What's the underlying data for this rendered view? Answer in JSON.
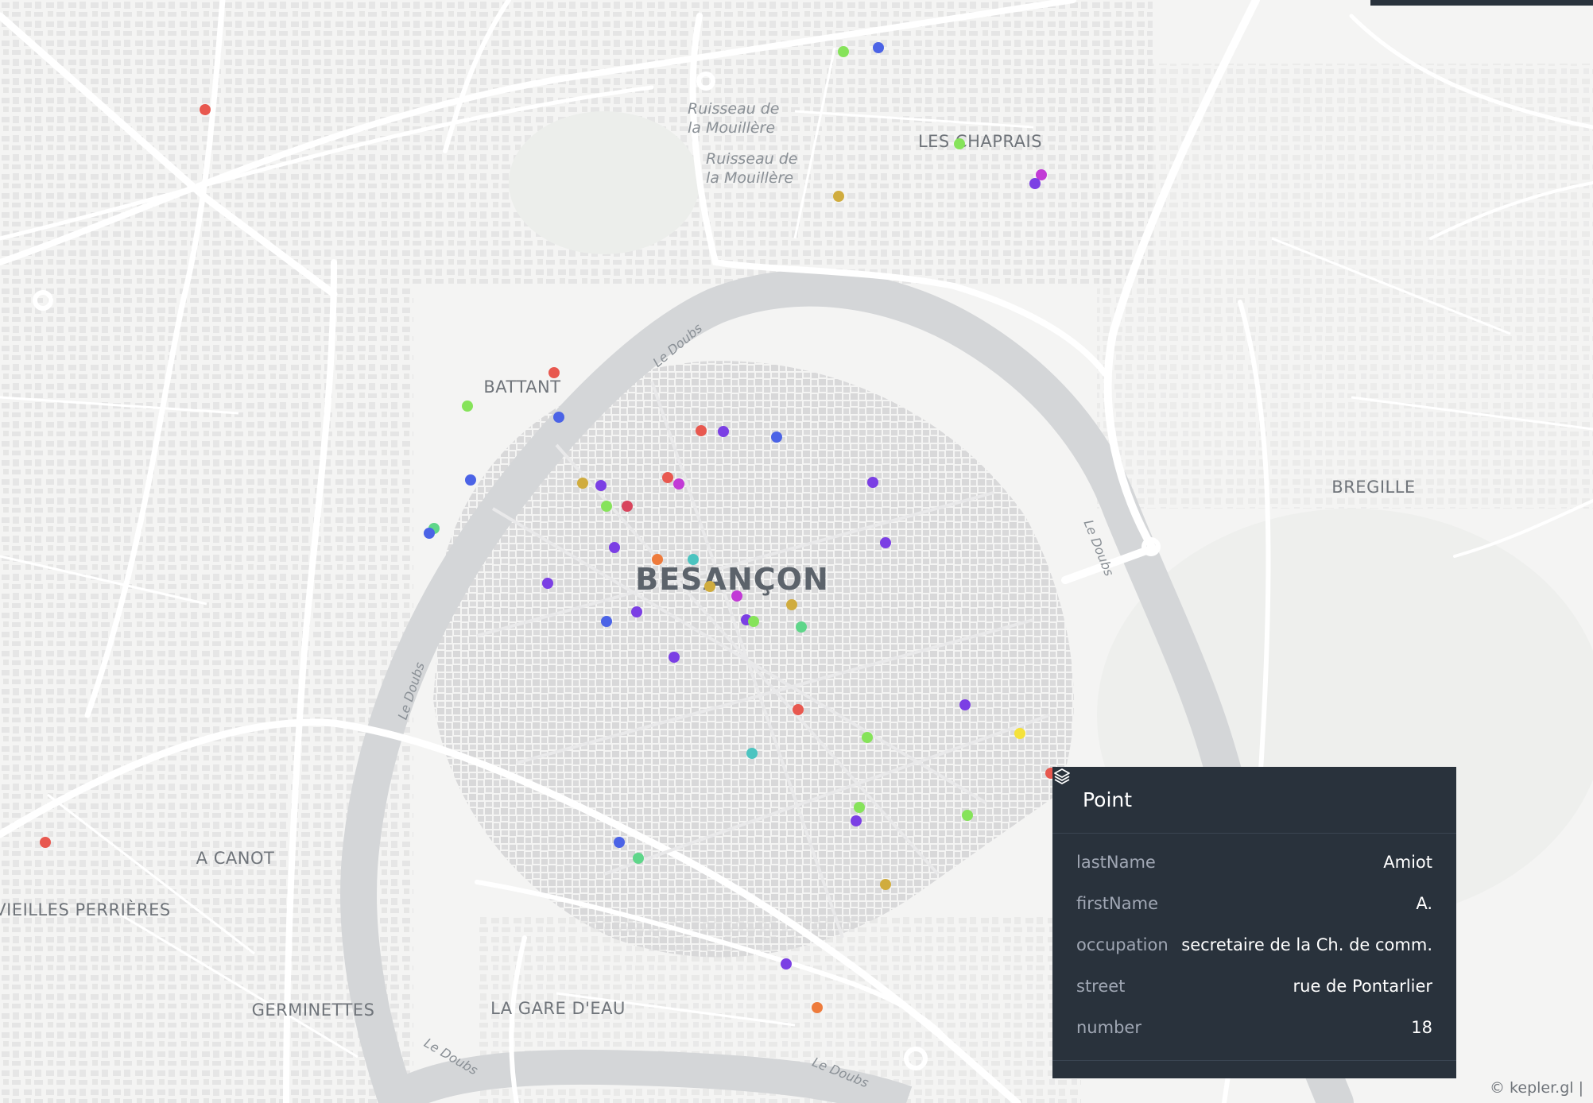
{
  "map": {
    "places": {
      "city": "BESANÇON",
      "les_chaprais": "LES CHAPRAIS",
      "battant": "BATTANT",
      "bregille": "BREGILLE",
      "a_canot": "A CANOT",
      "vieilles_perrieres": "VIEILLES PERRIÈRES",
      "germinettes": "GERMINETTES",
      "la_gare_deau": "LA GARE D'EAU"
    },
    "water_labels": {
      "ruisseau_1": "Ruisseau de\nla Mouillère",
      "ruisseau_2": "Ruisseau de\nla Mouillère"
    },
    "river_label": "Le Doubs",
    "point_colors": {
      "red": "#e8584f",
      "blue": "#4b63e6",
      "purple": "#7b3fe4",
      "magenta": "#c23ad6",
      "green": "#86e35a",
      "yellow": "#f5e23a",
      "gold": "#d0ac3e",
      "orange": "#ee7b3c",
      "teal": "#4cc4c0",
      "crimson": "#d8445c",
      "mint": "#5fd68a"
    }
  },
  "tooltip": {
    "layer_icon": "layers-icon",
    "layer_name": "Point",
    "fields": [
      {
        "key": "lastName",
        "value": "Amiot"
      },
      {
        "key": "firstName",
        "value": "A."
      },
      {
        "key": "occupation",
        "value": "secretaire de la Ch. de comm."
      },
      {
        "key": "street",
        "value": "rue de Pontarlier"
      },
      {
        "key": "number",
        "value": "18"
      }
    ]
  },
  "attribution": "© kepler.gl |"
}
